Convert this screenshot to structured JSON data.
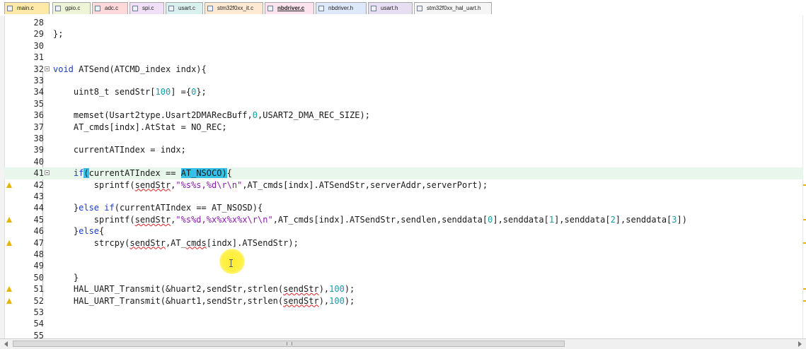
{
  "tabs": [
    {
      "label": "main.c",
      "color": "#ffe9a8",
      "active": false
    },
    {
      "label": "gpio.c",
      "color": "#eef4d6",
      "active": false
    },
    {
      "label": "adc.c",
      "color": "#ffd9d9",
      "active": false
    },
    {
      "label": "spi.c",
      "color": "#f0dff5",
      "active": false
    },
    {
      "label": "usart.c",
      "color": "#d9f1ee",
      "active": false
    },
    {
      "label": "stm32f0xx_it.c",
      "color": "#ffe9d3",
      "active": false
    },
    {
      "label": "nbdriver.c",
      "color": "#fde3ee",
      "active": true
    },
    {
      "label": "nbdriver.h",
      "color": "#dde8fa",
      "active": false
    },
    {
      "label": "usart.h",
      "color": "#e8def2",
      "active": false
    },
    {
      "label": "stm32f0xx_hal_uart.h",
      "color": "#f5f5f5",
      "active": false
    }
  ],
  "colors": {
    "keyword": "#1a3bc4",
    "string": "#8a1aa8",
    "number": "#1a9aa8",
    "highlight": "#36c0e6",
    "squiggle": "#e02020",
    "current_line": "#e8f6ec",
    "warning": "#e5b300"
  },
  "lines": [
    {
      "num": "28",
      "tokens": []
    },
    {
      "num": "29",
      "tokens": [
        {
          "t": "};"
        }
      ]
    },
    {
      "num": "30",
      "tokens": []
    },
    {
      "num": "31",
      "tokens": []
    },
    {
      "num": "32",
      "fold": true,
      "tokens": [
        {
          "t": "void",
          "c": "keyword"
        },
        {
          "t": " ATSend(ATCMD_index indx){"
        }
      ]
    },
    {
      "num": "33",
      "tokens": []
    },
    {
      "num": "34",
      "tokens": [
        {
          "t": "    uint8_t sendStr["
        },
        {
          "t": "100",
          "c": "number"
        },
        {
          "t": "] ={"
        },
        {
          "t": "0",
          "c": "number"
        },
        {
          "t": "};"
        }
      ]
    },
    {
      "num": "35",
      "tokens": []
    },
    {
      "num": "36",
      "tokens": [
        {
          "t": "    memset(Usart2type.Usart2DMARecBuff,"
        },
        {
          "t": "0",
          "c": "number"
        },
        {
          "t": ",USART2_DMA_REC_SIZE);"
        }
      ]
    },
    {
      "num": "37",
      "tokens": [
        {
          "t": "    AT_cmds[indx].AtStat = NO_REC;"
        }
      ]
    },
    {
      "num": "38",
      "tokens": []
    },
    {
      "num": "39",
      "tokens": [
        {
          "t": "    currentATIndex = indx;"
        }
      ]
    },
    {
      "num": "40",
      "tokens": []
    },
    {
      "num": "41",
      "fold": true,
      "current": true,
      "tokens": [
        {
          "t": "    "
        },
        {
          "t": "if",
          "c": "keyword"
        },
        {
          "t": "(",
          "c": "brace"
        },
        {
          "t": "currentATIndex == "
        },
        {
          "t": "AT_NSOCO",
          "c": "sel"
        },
        {
          "t": ")",
          "c": "brace"
        },
        {
          "t": "{"
        }
      ]
    },
    {
      "num": "42",
      "warn": true,
      "tokens": [
        {
          "t": "        sprintf("
        },
        {
          "t": "sendStr",
          "c": "squiggle"
        },
        {
          "t": ","
        },
        {
          "t": "\"%s%s,%d\\r\\n\"",
          "c": "string"
        },
        {
          "t": ",AT_cmds[indx].ATSendStr,serverAddr,serverPort);"
        }
      ]
    },
    {
      "num": "43",
      "tokens": []
    },
    {
      "num": "44",
      "tokens": [
        {
          "t": "    }"
        },
        {
          "t": "else",
          "c": "keyword"
        },
        {
          "t": " "
        },
        {
          "t": "if",
          "c": "keyword"
        },
        {
          "t": "(currentATIndex == AT_NSOSD){"
        }
      ]
    },
    {
      "num": "45",
      "warn": true,
      "tokens": [
        {
          "t": "        sprintf("
        },
        {
          "t": "sendStr",
          "c": "squiggle"
        },
        {
          "t": ","
        },
        {
          "t": "\"%s%d,%x%x%x%x\\r\\n\"",
          "c": "string"
        },
        {
          "t": ",AT_cmds[indx].ATSendStr,sendlen,senddata["
        },
        {
          "t": "0",
          "c": "number"
        },
        {
          "t": "],senddata["
        },
        {
          "t": "1",
          "c": "number"
        },
        {
          "t": "],senddata["
        },
        {
          "t": "2",
          "c": "number"
        },
        {
          "t": "],senddata["
        },
        {
          "t": "3",
          "c": "number"
        },
        {
          "t": "])"
        }
      ]
    },
    {
      "num": "46",
      "tokens": [
        {
          "t": "    }"
        },
        {
          "t": "else",
          "c": "keyword"
        },
        {
          "t": "{"
        }
      ]
    },
    {
      "num": "47",
      "warn": true,
      "tokens": [
        {
          "t": "        strcpy("
        },
        {
          "t": "sendStr",
          "c": "squiggle"
        },
        {
          "t": ",AT_"
        },
        {
          "t": "cmds",
          "c": "squiggle"
        },
        {
          "t": "[indx].ATSendStr);"
        }
      ]
    },
    {
      "num": "48",
      "tokens": []
    },
    {
      "num": "49",
      "tokens": []
    },
    {
      "num": "50",
      "tokens": [
        {
          "t": "    }"
        }
      ]
    },
    {
      "num": "51",
      "warn": true,
      "tokens": [
        {
          "t": "    HAL_UART_Transmit(&huart2,sendStr,strlen("
        },
        {
          "t": "sendStr",
          "c": "squiggle"
        },
        {
          "t": "),"
        },
        {
          "t": "100",
          "c": "number"
        },
        {
          "t": ");"
        }
      ]
    },
    {
      "num": "52",
      "warn": true,
      "tokens": [
        {
          "t": "    HAL_UART_Transmit(&huart1,sendStr,strlen("
        },
        {
          "t": "sendStr",
          "c": "squiggle"
        },
        {
          "t": "),"
        },
        {
          "t": "100",
          "c": "number"
        },
        {
          "t": ");"
        }
      ]
    },
    {
      "num": "53",
      "tokens": []
    },
    {
      "num": "54",
      "tokens": []
    },
    {
      "num": "55",
      "tokens": []
    }
  ]
}
